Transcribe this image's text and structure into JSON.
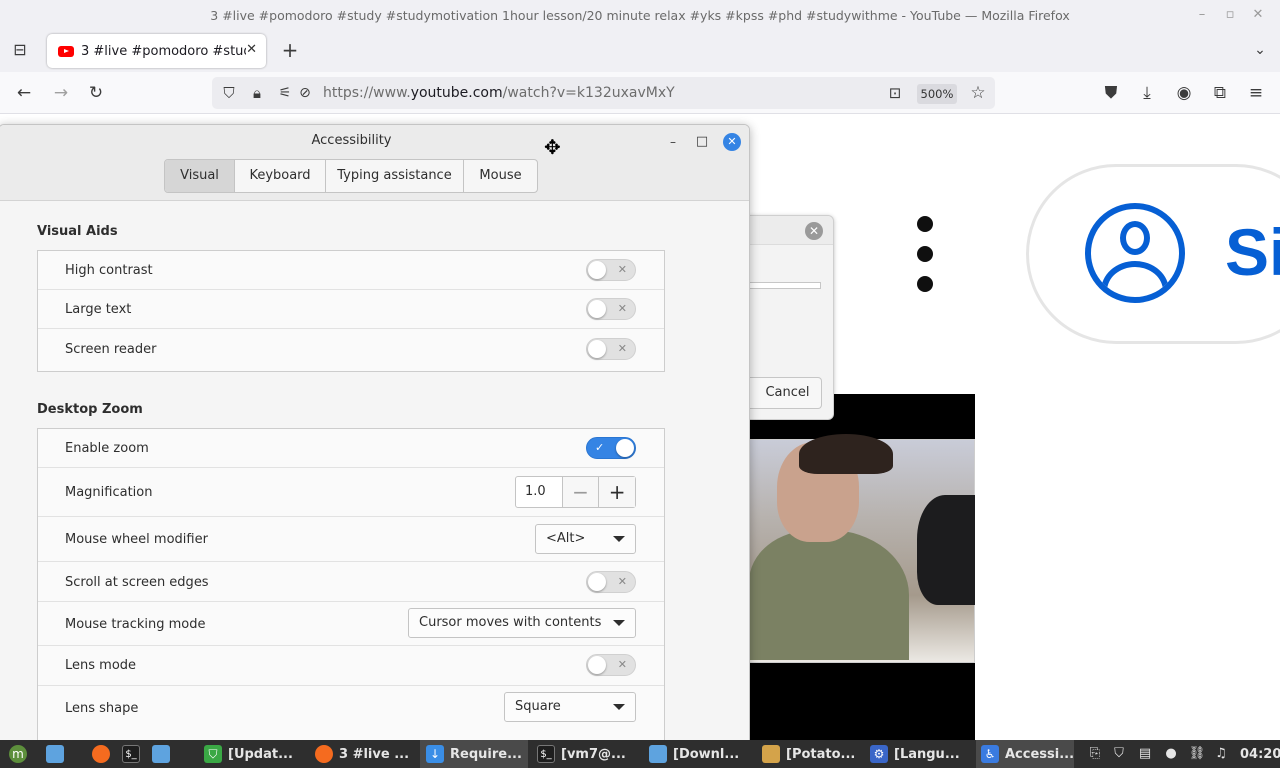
{
  "browser": {
    "window_title": "3 #live #pomodoro #study #studymotivation 1hour lesson/20 minute relax #yks #kpss #phd #studywithme - YouTube — Mozilla Firefox",
    "tab_title": "3 #live #pomodoro #study",
    "url_prefix": "https://www.",
    "url_domain": "youtube.com",
    "url_path": "/watch?v=k132uxavMxY",
    "zoom": "500%"
  },
  "page": {
    "signin_text": "Si",
    "behind_dialog_cancel": "Cancel"
  },
  "a11y": {
    "title": "Accessibility",
    "tabs": [
      {
        "label": "Visual",
        "active": true
      },
      {
        "label": "Keyboard",
        "active": false
      },
      {
        "label": "Typing assistance",
        "active": false
      },
      {
        "label": "Mouse",
        "active": false
      }
    ],
    "visual_aids": {
      "heading": "Visual Aids",
      "rows": [
        {
          "label": "High contrast",
          "on": false
        },
        {
          "label": "Large text",
          "on": false
        },
        {
          "label": "Screen reader",
          "on": false
        }
      ]
    },
    "zoom": {
      "heading": "Desktop Zoom",
      "enable_zoom_label": "Enable zoom",
      "enable_zoom_on": true,
      "magnification_label": "Magnification",
      "magnification_value": "1.0",
      "wheel_label": "Mouse wheel modifier",
      "wheel_value": "<Alt>",
      "edges_label": "Scroll at screen edges",
      "edges_on": false,
      "tracking_label": "Mouse tracking mode",
      "tracking_value": "Cursor moves with contents",
      "lens_mode_label": "Lens mode",
      "lens_mode_on": false,
      "lens_shape_label": "Lens shape",
      "lens_shape_value": "Square"
    }
  },
  "taskbar": {
    "items": [
      {
        "label": "[Updat...",
        "icon": "shield-icon",
        "color": "#3aa845"
      },
      {
        "label": "3 #live ...",
        "icon": "firefox-icon",
        "color": "#f56b1f"
      },
      {
        "label": "Require...",
        "icon": "download-icon",
        "color": "#3a8ee6"
      },
      {
        "label": "[vm7@...",
        "icon": "terminal-icon",
        "color": "#1e1e1e"
      },
      {
        "label": "[Downl...",
        "icon": "folder-icon",
        "color": "#5ea3df"
      },
      {
        "label": "[Potato...",
        "icon": "potato-icon",
        "color": "#d4a34a"
      },
      {
        "label": "[Langu...",
        "icon": "language-icon",
        "color": "#3a66c8"
      },
      {
        "label": "Accessi...",
        "icon": "accessibility-icon",
        "color": "#3a7be0"
      }
    ],
    "clock": "04:20"
  }
}
